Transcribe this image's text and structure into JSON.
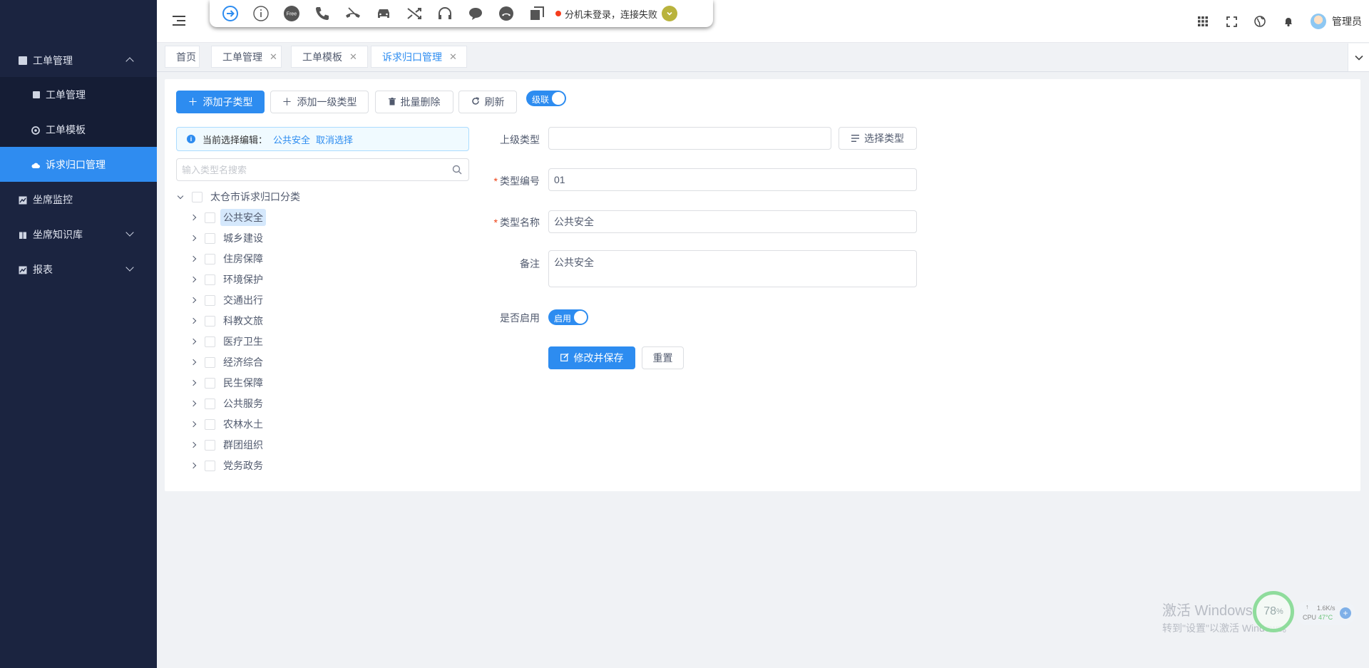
{
  "sidebar": {
    "items": [
      {
        "label": "工单管理",
        "icon": "document-icon"
      },
      {
        "label": "工单管理",
        "icon": "list-icon"
      },
      {
        "label": "工单模板",
        "icon": "gear-icon"
      },
      {
        "label": "诉求归口管理",
        "icon": "cloud-icon"
      },
      {
        "label": "坐席监控",
        "icon": "chart-icon"
      },
      {
        "label": "坐席知识库",
        "icon": "book-icon"
      },
      {
        "label": "报表",
        "icon": "chart-icon"
      }
    ]
  },
  "softphone": {
    "icons": [
      "login-arrow-icon",
      "info-icon",
      "free-icon",
      "phone-icon",
      "hangup-icon",
      "car-icon",
      "transfer-icon",
      "headset-icon",
      "chat-icon",
      "hold-icon",
      "copy-icon"
    ],
    "free_label": "Free",
    "status": "分机未登录，连接失败",
    "status_color": "#f53d1d"
  },
  "header": {
    "user": "管理员",
    "icons": [
      "apps-grid-icon",
      "fullscreen-icon",
      "globe-icon",
      "bell-icon"
    ]
  },
  "tabs": [
    {
      "label": "首页",
      "closable": false
    },
    {
      "label": "工单管理",
      "closable": true
    },
    {
      "label": "工单模板",
      "closable": true
    },
    {
      "label": "诉求归口管理",
      "closable": true,
      "active": true
    }
  ],
  "toolbar": {
    "add_child": "添加子类型",
    "add_top": "添加一级类型",
    "batch_delete": "批量删除",
    "refresh": "刷新",
    "cascade_switch": "级联"
  },
  "selection_alert": {
    "prefix": "当前选择编辑：",
    "selected": "公共安全",
    "cancel": "取消选择"
  },
  "search": {
    "placeholder": "输入类型名搜索"
  },
  "tree": {
    "root": "太仓市诉求归口分类",
    "children": [
      "公共安全",
      "城乡建设",
      "住房保障",
      "环境保护",
      "交通出行",
      "科教文旅",
      "医疗卫生",
      "经济综合",
      "民生保障",
      "公共服务",
      "农林水土",
      "群团组织",
      "党务政务"
    ],
    "selected_index": 0
  },
  "form": {
    "parent_label": "上级类型",
    "parent_value": "",
    "select_type_btn": "选择类型",
    "code_label": "类型编号",
    "code_value": "01",
    "name_label": "类型名称",
    "name_value": "公共安全",
    "remark_label": "备注",
    "remark_value": "公共安全",
    "enabled_label": "是否启用",
    "enabled_switch": "启用",
    "save_btn": "修改并保存",
    "reset_btn": "重置",
    "required_mark": "*"
  },
  "watermark": {
    "title": "激活 Windows",
    "subtitle": "转到\"设置\"以激活 Windows。"
  },
  "system_widget": {
    "cpu_percent": "78",
    "percent_sign": "%",
    "net_speed": "1.6K/s",
    "cpu_label": "CPU",
    "temperature": "47°C"
  },
  "colors": {
    "primary": "#2d8cf0",
    "sidebar_bg": "#1b2440",
    "active_menu": "#2f8cf0"
  }
}
